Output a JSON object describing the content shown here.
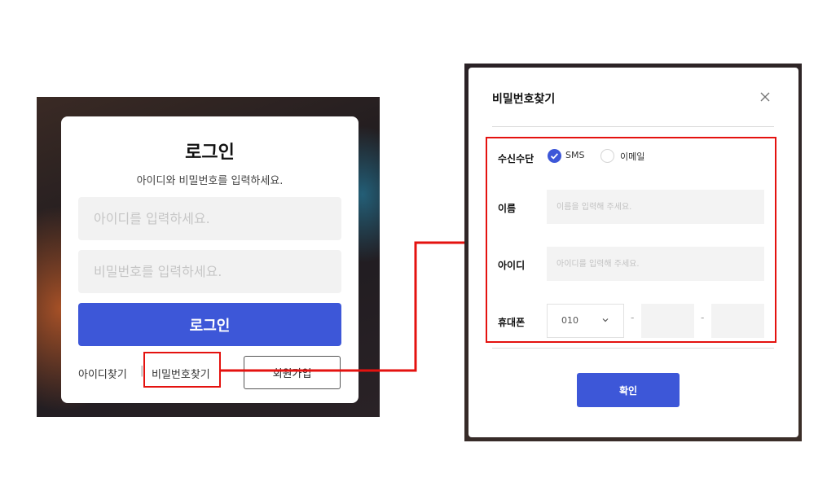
{
  "login": {
    "title": "로그인",
    "subtitle": "아이디와 비밀번호를 입력하세요.",
    "id_placeholder": "아이디를 입력하세요.",
    "pw_placeholder": "비밀번호를 입력하세요.",
    "login_button": "로그인",
    "find_id": "아이디찾기",
    "separator": "|",
    "find_pw": "비밀번호찾기",
    "signup": "회원가입"
  },
  "modal": {
    "title": "비밀번호찾기",
    "method_label": "수신수단",
    "method_options": [
      {
        "label": "SMS",
        "selected": true
      },
      {
        "label": "이메일",
        "selected": false
      }
    ],
    "name_label": "이름",
    "name_placeholder": "이름을 입력해 주세요.",
    "id_label": "아이디",
    "id_placeholder": "아이디를 입력해 주세요.",
    "phone_label": "휴대폰",
    "phone_prefix": "010",
    "phone_dash": "-",
    "confirm_button": "확인"
  },
  "colors": {
    "accent": "#3d57d8",
    "highlight": "#e4120f"
  },
  "icons": {
    "close": "close-icon",
    "check": "check-icon",
    "dropdown": "chevron-down-icon"
  }
}
